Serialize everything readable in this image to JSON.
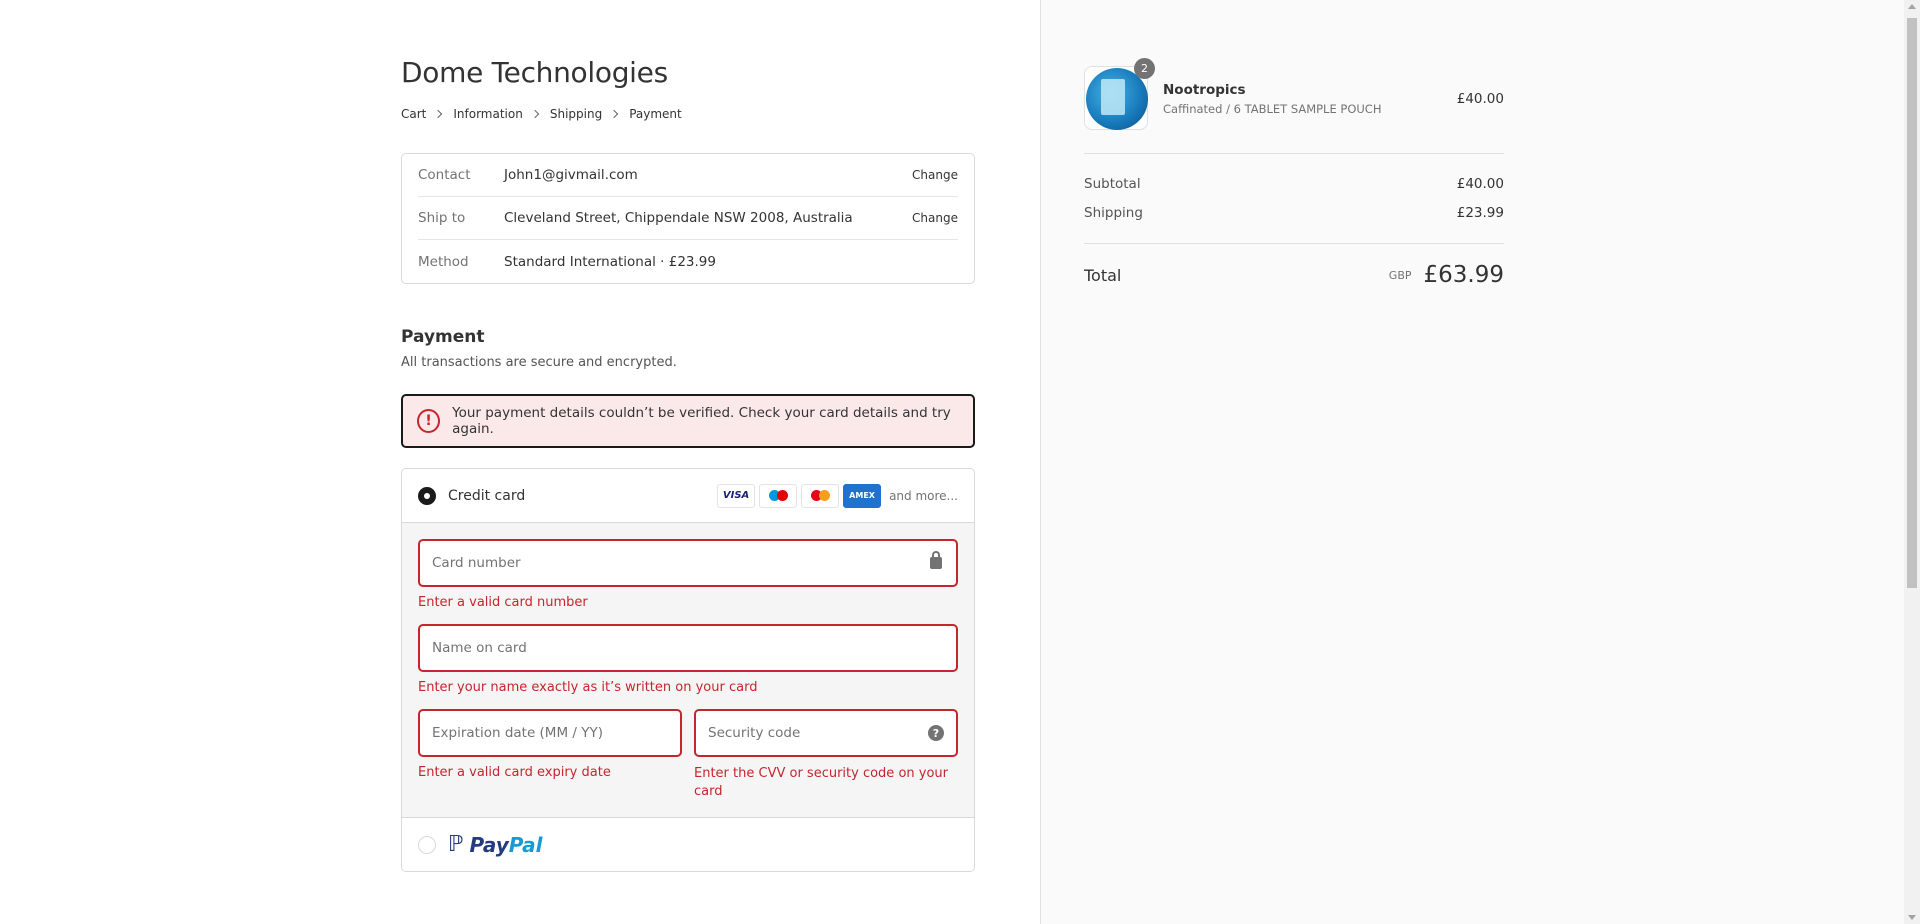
{
  "store": {
    "title": "Dome Technologies"
  },
  "breadcrumb": [
    "Cart",
    "Information",
    "Shipping",
    "Payment"
  ],
  "review": {
    "contact": {
      "label": "Contact",
      "value": "John1@givmail.com",
      "action": "Change"
    },
    "ship_to": {
      "label": "Ship to",
      "value": "Cleveland Street, Chippendale NSW 2008, Australia",
      "action": "Change"
    },
    "method": {
      "label": "Method",
      "value_prefix": "Standard International · ",
      "value_price": "£23.99"
    }
  },
  "payment": {
    "heading": "Payment",
    "subtitle": "All transactions are secure and encrypted.",
    "error": "Your payment details couldn’t be verified. Check your card details and try again.",
    "credit_card": {
      "label": "Credit card",
      "brands": [
        "VISA",
        "maestro",
        "mastercard",
        "AMEX"
      ],
      "more": "and more...",
      "card_number": {
        "placeholder": "Card number",
        "error": "Enter a valid card number"
      },
      "name_on_card": {
        "placeholder": "Name on card",
        "error": "Enter your name exactly as it’s written on your card"
      },
      "expiry": {
        "placeholder": "Expiration date (MM / YY)",
        "error": "Enter a valid card expiry date"
      },
      "security": {
        "placeholder": "Security code",
        "error": "Enter the CVV or security code on your card"
      }
    },
    "paypal": {
      "label_p": "Pay",
      "label_pal": "Pal"
    }
  },
  "order": {
    "item": {
      "name": "Nootropics",
      "variant": "Caffinated / 6 TABLET SAMPLE POUCH",
      "price": "£40.00",
      "quantity": "2"
    },
    "subtotal": {
      "label": "Subtotal",
      "value": "£40.00"
    },
    "shipping": {
      "label": "Shipping",
      "value": "£23.99"
    },
    "total": {
      "label": "Total",
      "currency": "GBP",
      "value": "£63.99"
    }
  },
  "colors": {
    "error": "#c7252d",
    "sidebar_bg": "#fafafa"
  }
}
